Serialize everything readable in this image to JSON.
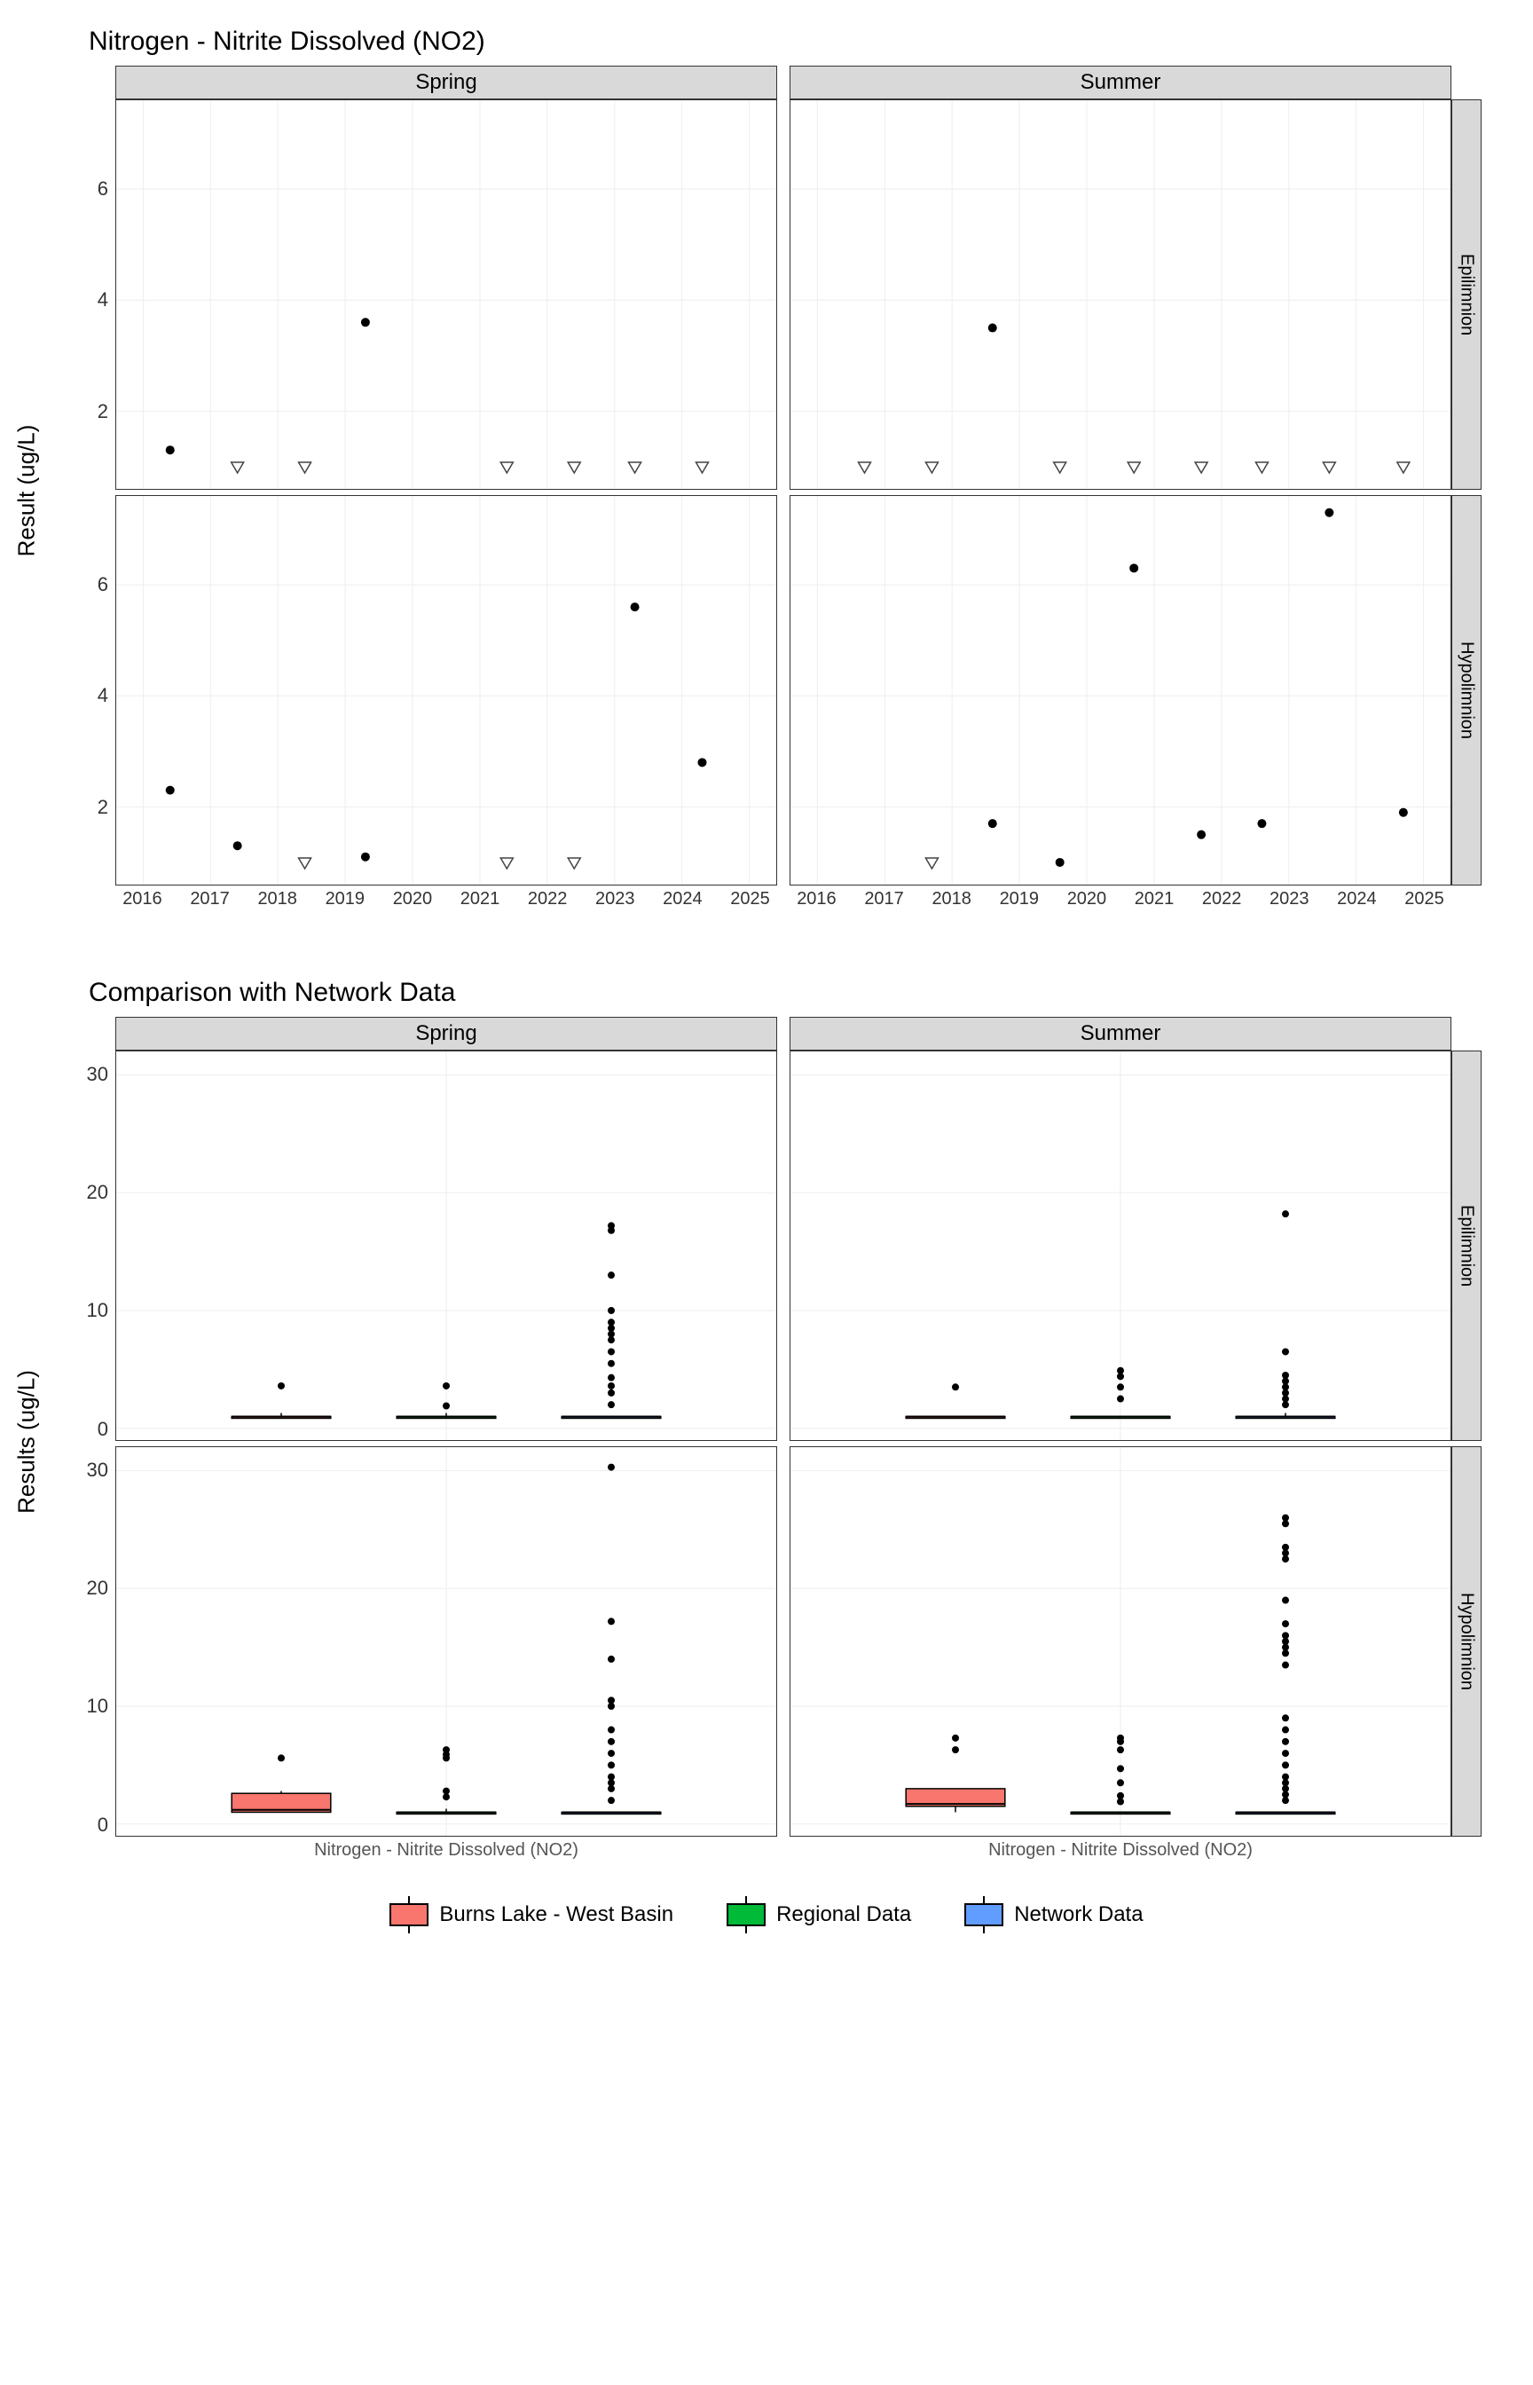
{
  "chart1": {
    "title": "Nitrogen - Nitrite Dissolved (NO2)",
    "ylabel": "Result (ug/L)",
    "col_facets": [
      "Spring",
      "Summer"
    ],
    "row_facets": [
      "Epilimnion",
      "Hypolimnion"
    ],
    "x_ticks": [
      2016,
      2017,
      2018,
      2019,
      2020,
      2021,
      2022,
      2023,
      2024,
      2025
    ],
    "y_ticks": [
      2,
      4,
      6
    ],
    "y_range": [
      0.6,
      7.6
    ]
  },
  "chart2": {
    "title": "Comparison with Network Data",
    "ylabel": "Results (ug/L)",
    "col_facets": [
      "Spring",
      "Summer"
    ],
    "row_facets": [
      "Epilimnion",
      "Hypolimnion"
    ],
    "x_category_label": "Nitrogen - Nitrite Dissolved (NO2)",
    "y_ticks": [
      0,
      10,
      20,
      30
    ],
    "y_range": [
      -1,
      32
    ]
  },
  "legend": {
    "items": [
      {
        "label": "Burns Lake - West Basin",
        "color": "#f8766d"
      },
      {
        "label": "Regional Data",
        "color": "#00ba38"
      },
      {
        "label": "Network Data",
        "color": "#619cff"
      }
    ]
  },
  "chart_data": [
    {
      "type": "scatter",
      "title": "Nitrogen - Nitrite Dissolved (NO2)",
      "ylabel": "Result (ug/L)",
      "ylim": [
        0.6,
        7.6
      ],
      "x": "year",
      "facets": {
        "col": [
          "Spring",
          "Summer"
        ],
        "row": [
          "Epilimnion",
          "Hypolimnion"
        ]
      },
      "series": [
        {
          "name": "detected",
          "shape": "dot",
          "panels": {
            "Spring|Epilimnion": [
              {
                "x": 2016.4,
                "y": 1.3
              },
              {
                "x": 2019.3,
                "y": 3.6
              }
            ],
            "Spring|Hypolimnion": [
              {
                "x": 2016.4,
                "y": 2.3
              },
              {
                "x": 2017.4,
                "y": 1.3
              },
              {
                "x": 2019.3,
                "y": 1.1
              },
              {
                "x": 2023.3,
                "y": 5.6
              },
              {
                "x": 2024.3,
                "y": 2.8
              }
            ],
            "Summer|Epilimnion": [
              {
                "x": 2018.6,
                "y": 3.5
              }
            ],
            "Summer|Hypolimnion": [
              {
                "x": 2018.6,
                "y": 1.7
              },
              {
                "x": 2019.6,
                "y": 1.0
              },
              {
                "x": 2020.7,
                "y": 6.3
              },
              {
                "x": 2021.7,
                "y": 1.5
              },
              {
                "x": 2022.6,
                "y": 1.7
              },
              {
                "x": 2023.6,
                "y": 7.3
              },
              {
                "x": 2024.7,
                "y": 1.9
              }
            ]
          }
        },
        {
          "name": "non-detect",
          "shape": "open-triangle-down",
          "panels": {
            "Spring|Epilimnion": [
              {
                "x": 2017.4,
                "y": 1.0
              },
              {
                "x": 2018.4,
                "y": 1.0
              },
              {
                "x": 2021.4,
                "y": 1.0
              },
              {
                "x": 2022.4,
                "y": 1.0
              },
              {
                "x": 2023.3,
                "y": 1.0
              },
              {
                "x": 2024.3,
                "y": 1.0
              }
            ],
            "Spring|Hypolimnion": [
              {
                "x": 2018.4,
                "y": 1.0
              },
              {
                "x": 2021.4,
                "y": 1.0
              },
              {
                "x": 2022.4,
                "y": 1.0
              }
            ],
            "Summer|Epilimnion": [
              {
                "x": 2016.7,
                "y": 1.0
              },
              {
                "x": 2017.7,
                "y": 1.0
              },
              {
                "x": 2019.6,
                "y": 1.0
              },
              {
                "x": 2020.7,
                "y": 1.0
              },
              {
                "x": 2021.7,
                "y": 1.0
              },
              {
                "x": 2022.6,
                "y": 1.0
              },
              {
                "x": 2023.6,
                "y": 1.0
              },
              {
                "x": 2024.7,
                "y": 1.0
              }
            ],
            "Summer|Hypolimnion": [
              {
                "x": 2017.7,
                "y": 1.0
              }
            ]
          }
        }
      ]
    },
    {
      "type": "boxplot",
      "title": "Comparison with Network Data",
      "ylabel": "Results (ug/L)",
      "ylim": [
        -1,
        32
      ],
      "x_category": "Nitrogen - Nitrite Dissolved (NO2)",
      "groups": [
        "Burns Lake - West Basin",
        "Regional Data",
        "Network Data"
      ],
      "colors": {
        "Burns Lake - West Basin": "#f8766d",
        "Regional Data": "#00ba38",
        "Network Data": "#619cff"
      },
      "facets": {
        "col": [
          "Spring",
          "Summer"
        ],
        "row": [
          "Epilimnion",
          "Hypolimnion"
        ]
      },
      "panels": {
        "Spring|Epilimnion": {
          "Burns Lake - West Basin": {
            "min": 1.0,
            "q1": 1.0,
            "med": 1.0,
            "q3": 1.0,
            "max": 1.3,
            "outliers": [
              3.6
            ]
          },
          "Regional Data": {
            "min": 1.0,
            "q1": 1.0,
            "med": 1.0,
            "q3": 1.0,
            "max": 1.3,
            "outliers": [
              1.9,
              3.6
            ]
          },
          "Network Data": {
            "min": 1.0,
            "q1": 1.0,
            "med": 1.0,
            "q3": 1.0,
            "max": 1.0,
            "outliers": [
              2,
              3,
              3.6,
              4.3,
              5.5,
              6.5,
              7.5,
              8,
              8.5,
              9,
              10,
              13,
              16.8,
              17.2
            ]
          }
        },
        "Spring|Hypolimnion": {
          "Burns Lake - West Basin": {
            "min": 1.0,
            "q1": 1.0,
            "med": 1.2,
            "q3": 2.6,
            "max": 2.8,
            "outliers": [
              5.6
            ]
          },
          "Regional Data": {
            "min": 1.0,
            "q1": 1.0,
            "med": 1.0,
            "q3": 1.0,
            "max": 1.3,
            "outliers": [
              2.3,
              2.8,
              5.6,
              5.9,
              6.3
            ]
          },
          "Network Data": {
            "min": 1.0,
            "q1": 1.0,
            "med": 1.0,
            "q3": 1.0,
            "max": 1.0,
            "outliers": [
              2,
              3,
              3.5,
              4,
              5,
              6,
              7,
              8,
              10,
              10.5,
              14,
              17.2,
              30.3
            ]
          }
        },
        "Summer|Epilimnion": {
          "Burns Lake - West Basin": {
            "min": 1.0,
            "q1": 1.0,
            "med": 1.0,
            "q3": 1.0,
            "max": 1.0,
            "outliers": [
              3.5
            ]
          },
          "Regional Data": {
            "min": 1.0,
            "q1": 1.0,
            "med": 1.0,
            "q3": 1.0,
            "max": 1.0,
            "outliers": [
              2.5,
              3.5,
              4.4,
              4.9
            ]
          },
          "Network Data": {
            "min": 1.0,
            "q1": 1.0,
            "med": 1.0,
            "q3": 1.0,
            "max": 1.3,
            "outliers": [
              2,
              2.5,
              3,
              3.5,
              4,
              4.5,
              6.5,
              18.2
            ]
          }
        },
        "Summer|Hypolimnion": {
          "Burns Lake - West Basin": {
            "min": 1.0,
            "q1": 1.5,
            "med": 1.7,
            "q3": 3.0,
            "max": 1.9,
            "outliers": [
              6.3,
              7.3
            ]
          },
          "Regional Data": {
            "min": 1.0,
            "q1": 1.0,
            "med": 1.0,
            "q3": 1.0,
            "max": 1.0,
            "outliers": [
              1.9,
              2.4,
              3.5,
              4.7,
              6.3,
              7.0,
              7.3
            ]
          },
          "Network Data": {
            "min": 1.0,
            "q1": 1.0,
            "med": 1.0,
            "q3": 1.0,
            "max": 1.0,
            "outliers": [
              2,
              2.5,
              3,
              3.5,
              4,
              5,
              6,
              7,
              8,
              9,
              13.5,
              14.5,
              15,
              15.5,
              16,
              17,
              19,
              22.5,
              23,
              23.5,
              25.5,
              26
            ]
          }
        }
      }
    }
  ]
}
